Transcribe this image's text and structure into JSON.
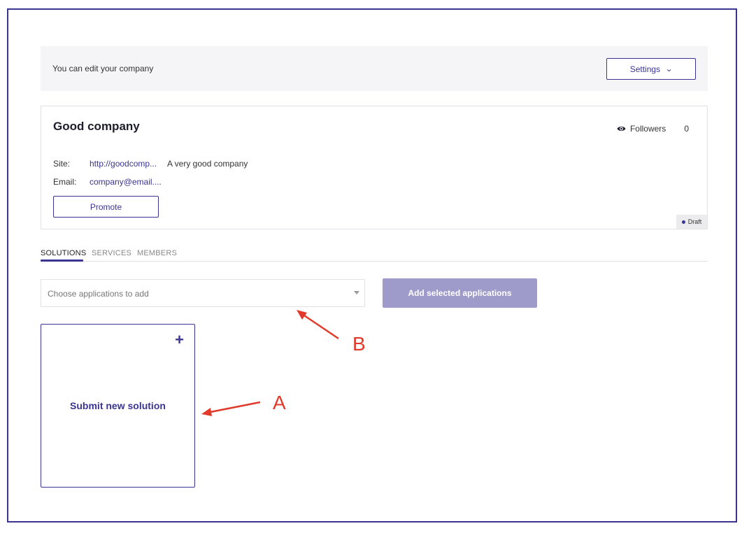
{
  "notice": {
    "text": "You can edit your company",
    "settings_label": "Settings"
  },
  "company": {
    "name": "Good company",
    "followers_label": "Followers",
    "followers_count": "0",
    "site_label": "Site:",
    "site_value": "http://goodcomp...",
    "description": "A very good company",
    "email_label": "Email:",
    "email_value": "company@email....",
    "promote_label": "Promote",
    "status": "Draft"
  },
  "tabs": [
    {
      "label": "SOLUTIONS",
      "active": true
    },
    {
      "label": "SERVICES",
      "active": false
    },
    {
      "label": "MEMBERS",
      "active": false
    }
  ],
  "applications": {
    "placeholder": "Choose applications to add",
    "add_button_label": "Add selected applications"
  },
  "submit_card": {
    "label": "Submit new solution"
  },
  "annotations": [
    {
      "letter": "A"
    },
    {
      "letter": "B"
    }
  ],
  "colors": {
    "accent": "#3a3590",
    "disabled_button": "#9e9bcb",
    "annotation": "#e23a2a"
  }
}
